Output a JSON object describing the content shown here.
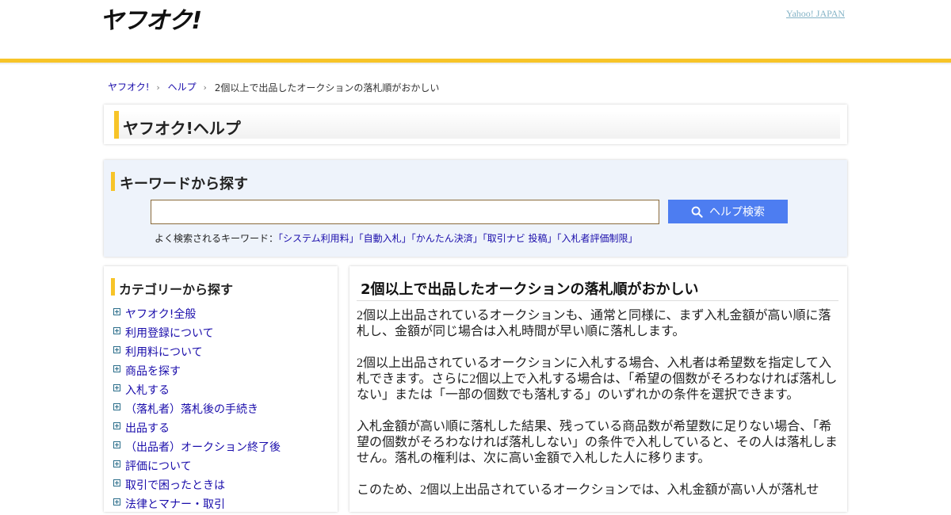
{
  "header": {
    "logo_text": "ヤフオク!",
    "yahoo_link": "Yahoo! JAPAN"
  },
  "breadcrumb": [
    {
      "label": "ヤフオク!"
    },
    {
      "label": "ヘルプ"
    },
    {
      "label": "2個以上で出品したオークションの落札順がおかしい"
    }
  ],
  "help_title": "ヤフオク!ヘルプ",
  "search": {
    "heading": "キーワードから探す",
    "input_value": "",
    "button_label": "ヘルプ検索",
    "popular_prefix": "よく検索されるキーワード：",
    "popular_keywords": [
      "「システム利用料」",
      "「自動入札」",
      "「かんたん決済」",
      "「取引ナビ 投稿」",
      "「入札者評価制限」"
    ]
  },
  "category": {
    "heading": "カテゴリーから探す",
    "items": [
      "ヤフオク!全般",
      "利用登録について",
      "利用料について",
      "商品を探す",
      "入札する",
      "（落札者）落札後の手続き",
      "出品する",
      "（出品者）オークション終了後",
      "評価について",
      "取引で困ったときは",
      "法律とマナー・取引"
    ]
  },
  "article": {
    "title": "2個以上で出品したオークションの落札順がおかしい",
    "paragraphs": [
      "2個以上出品されているオークションも、通常と同様に、まず入札金額が高い順に落札し、金額が同じ場合は入札時間が早い順に落札します。",
      "2個以上出品されているオークションに入札する場合、入札者は希望数を指定して入札できます。さらに2個以上で入札する場合は、「希望の個数がそろわなければ落札しない」または「一部の個数でも落札する」のいずれかの条件を選択できます。",
      "入札金額が高い順に落札した結果、残っている商品数が希望数に足りない場合、「希望の個数がそろわなければ落札しない」の条件で入札していると、その人は落札しません。落札の権利は、次に高い金額で入札した人に移ります。",
      "このため、2個以上出品されているオークションでは、入札金額が高い人が落札せ"
    ]
  },
  "colors": {
    "accent_yellow": "#f7c428",
    "search_button": "#4d7df1",
    "link": "#1a0dab"
  }
}
